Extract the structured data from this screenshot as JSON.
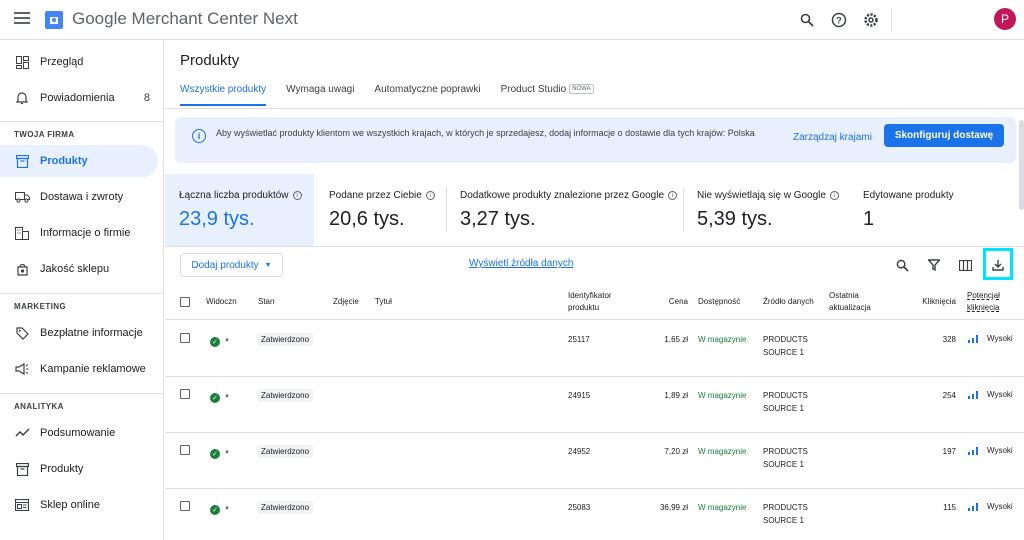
{
  "app": {
    "title": "Google Merchant Center Next",
    "avatar_letter": "P"
  },
  "sidebar": {
    "items": [
      {
        "label": "Przegląd",
        "icon": "dashboard-icon"
      },
      {
        "label": "Powiadomienia",
        "icon": "bell-icon",
        "count": "8"
      },
      {
        "label": "Produkty",
        "icon": "products-icon",
        "active": true
      },
      {
        "label": "Dostawa i zwroty",
        "icon": "truck-icon"
      },
      {
        "label": "Informacje o firmie",
        "icon": "business-icon"
      },
      {
        "label": "Jakość sklepu",
        "icon": "quality-icon"
      },
      {
        "label": "Bezpłatne informacje",
        "icon": "tag-icon"
      },
      {
        "label": "Kampanie reklamowe",
        "icon": "megaphone-icon"
      },
      {
        "label": "Podsumowanie",
        "icon": "trend-icon"
      },
      {
        "label": "Produkty",
        "icon": "products-icon"
      },
      {
        "label": "Sklep online",
        "icon": "store-icon"
      }
    ],
    "sections": [
      "TWOJA FIRMA",
      "MARKETING",
      "ANALITYKA"
    ]
  },
  "page": {
    "title": "Produkty"
  },
  "tabs": [
    {
      "label": "Wszystkie produkty",
      "active": true
    },
    {
      "label": "Wymaga uwagi"
    },
    {
      "label": "Automatyczne poprawki"
    },
    {
      "label": "Product Studio",
      "badge": "NOWA"
    }
  ],
  "banner": {
    "text": "Aby wyświetlać produkty klientom we wszystkich krajach, w których je sprzedajesz, dodaj informacje o dostawie dla tych krajów: Polska",
    "link": "Zarządzaj krajami",
    "button": "Skonfiguruj dostawę"
  },
  "stats": [
    {
      "label": "Łączna liczba produktów",
      "value": "23,9 tys.",
      "info": true
    },
    {
      "label": "Podane przez Ciebie",
      "value": "20,6 tys.",
      "info": true
    },
    {
      "label": "Dodatkowe produkty znalezione przez Google",
      "value": "3,27 tys.",
      "info": true
    },
    {
      "label": "Nie wyświetlają się w Google",
      "value": "5,39 tys.",
      "info": true
    },
    {
      "label": "Edytowane produkty",
      "value": "1"
    }
  ],
  "toolbar": {
    "add_products": "Dodaj produkty",
    "show_sources": "Wyświetl źródła danych"
  },
  "table": {
    "headers": {
      "visible": "Widoczn",
      "status": "Stan",
      "image": "Zdjęcie",
      "title": "Tytuł",
      "product_id": "Identyfikator produktu",
      "price": "Cena",
      "availability": "Dostępność",
      "source": "Źródło danych",
      "updated": "Ostatnia aktualizacja",
      "clicks": "Kliknięcia",
      "potential": "Potencjał kliknięcia"
    },
    "rows": [
      {
        "status": "Zatwierdzono",
        "id": "25117",
        "price": "1,65 zł",
        "availability": "W magazynie",
        "source": "PRODUCTS SOURCE 1",
        "clicks": "328",
        "potential": "Wysoki"
      },
      {
        "status": "Zatwierdzono",
        "id": "24915",
        "price": "1,89 zł",
        "availability": "W magazynie",
        "source": "PRODUCTS SOURCE 1",
        "clicks": "254",
        "potential": "Wysoki"
      },
      {
        "status": "Zatwierdzono",
        "id": "24952",
        "price": "7,20 zł",
        "availability": "W magazynie",
        "source": "PRODUCTS SOURCE 1",
        "clicks": "197",
        "potential": "Wysoki"
      },
      {
        "status": "Zatwierdzono",
        "id": "25083",
        "price": "36,99 zł",
        "availability": "W magazynie",
        "source": "PRODUCTS SOURCE 1",
        "clicks": "115",
        "potential": "Wysoki"
      }
    ]
  },
  "colors": {
    "accent": "#1a73e8",
    "success": "#188038",
    "highlight": "#00e5ff"
  }
}
